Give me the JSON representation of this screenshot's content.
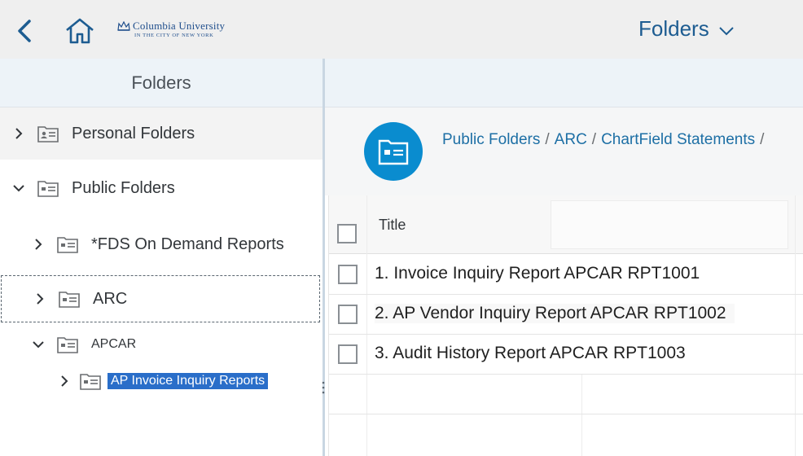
{
  "shell": {
    "logo_main": "Columbia University",
    "logo_sub": "IN THE CITY OF NEW YORK",
    "title": "Folders"
  },
  "left": {
    "header": "Folders",
    "tree": [
      {
        "label": "Personal Folders",
        "expanded": false,
        "level": 0
      },
      {
        "label": "Public Folders",
        "expanded": true,
        "level": 0
      },
      {
        "label": "*FDS On Demand Reports",
        "expanded": false,
        "level": 1
      },
      {
        "label": "ARC",
        "expanded": false,
        "level": 1,
        "focused": true
      },
      {
        "label": "APCAR",
        "expanded": true,
        "level": 1
      },
      {
        "label": "AP Invoice Inquiry Reports",
        "expanded": false,
        "level": 2,
        "selected": true
      }
    ]
  },
  "breadcrumb": {
    "items": [
      "Public Folders",
      "ARC",
      "ChartField Statements"
    ],
    "separator": "/"
  },
  "table": {
    "header_title": "Title",
    "rows": [
      "1. Invoice Inquiry Report APCAR RPT1001",
      "2. AP Vendor Inquiry Report APCAR RPT1002",
      "3. Audit History Report APCAR RPT1003"
    ]
  },
  "colors": {
    "accent": "#0a8ccf",
    "link": "#1d6fa5",
    "selection": "#2a6ec9",
    "shell_bg": "#efefef"
  },
  "icons": [
    "back-icon",
    "home-icon",
    "crown-icon",
    "chevron-down-icon",
    "chevron-right-icon",
    "folder-icon",
    "personal-folder-icon"
  ]
}
